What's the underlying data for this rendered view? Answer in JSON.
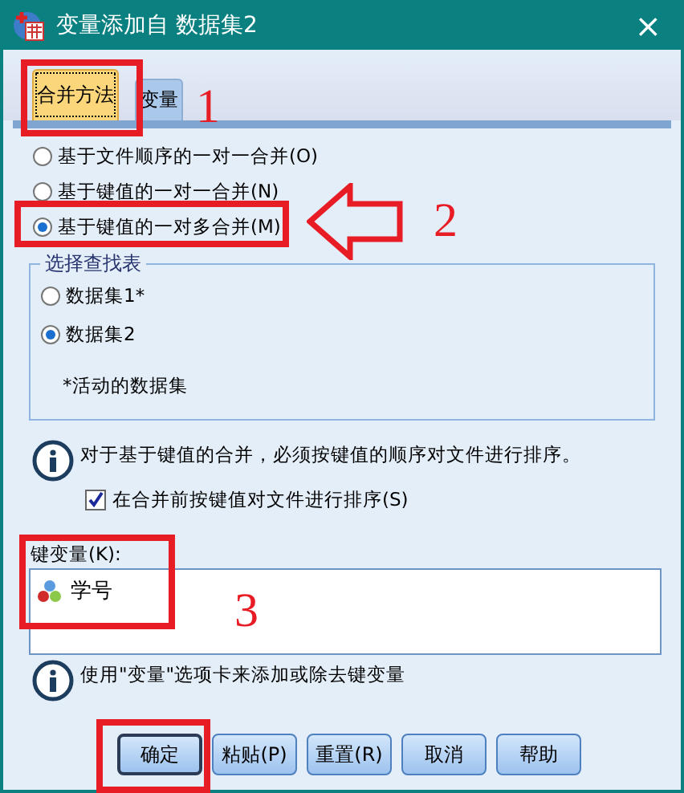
{
  "window": {
    "title": "变量添加自 数据集2",
    "close": "×"
  },
  "tabs": [
    {
      "label": "合并方法",
      "selected": true
    },
    {
      "label": "变量",
      "selected": false
    }
  ],
  "merge_options": [
    {
      "label": "基于文件顺序的一对一合并(O)",
      "selected": false
    },
    {
      "label": "基于键值的一对一合并(N)",
      "selected": false
    },
    {
      "label": "基于键值的一对多合并(M)",
      "selected": true
    }
  ],
  "lookup": {
    "title": "选择查找表",
    "options": [
      {
        "label": "数据集1*",
        "selected": false
      },
      {
        "label": "数据集2",
        "selected": true
      }
    ],
    "note": "*活动的数据集"
  },
  "info_sort": "对于基于键值的合并，必须按键值的顺序对文件进行排序。",
  "sort_checkbox": {
    "label": "在合并前按键值对文件进行排序(S)",
    "checked": true
  },
  "key_variables": {
    "label": "键变量(K):",
    "items": [
      "学号"
    ]
  },
  "info_keys": "使用\"变量\"选项卡来添加或除去键变量",
  "buttons": [
    {
      "label": "确定",
      "default": true
    },
    {
      "label": "粘贴(P)",
      "default": false
    },
    {
      "label": "重置(R)",
      "default": false
    },
    {
      "label": "取消",
      "default": false
    },
    {
      "label": "帮助",
      "default": false
    }
  ],
  "annotations": {
    "tabs_box": true,
    "option_box": true,
    "arrow": true,
    "keys_box": true,
    "ok_box": true,
    "numbers": [
      "1",
      "2",
      "3"
    ]
  }
}
